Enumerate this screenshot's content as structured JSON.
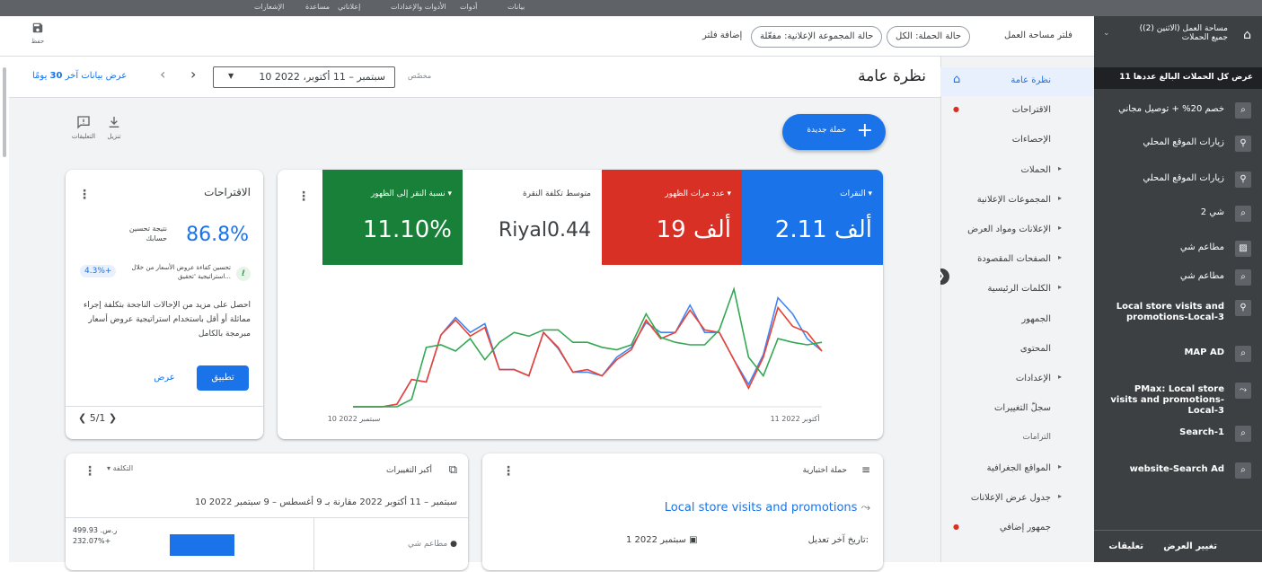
{
  "topbar": {
    "items": [
      "بيانات",
      "أدوات",
      "الأدوات والإعدادات",
      "إعلاناتي",
      "مساعدة",
      "الإشعارات"
    ]
  },
  "filters": {
    "add_filter": "إضافة فلتر",
    "chip_adgroup": "حالة المجموعة الإعلانية: مفعّلة",
    "chip_campaign": "حالة الحملة: الكل",
    "workspace_filter": "فلتر مساحة العمل",
    "save_label": "حفظ"
  },
  "account": {
    "line1": "مساحة العمل (الاثنين (2))",
    "line2": "جميع الحملات"
  },
  "campaign_nav": {
    "all_label": "عرض كل الحملات البالغ عددها 11",
    "items": [
      {
        "label": "خصم 20% + توصيل مجاني",
        "icon": "search-icon"
      },
      {
        "label": "زيارات الموقع المحلي",
        "icon": "location-icon"
      },
      {
        "label": "زيارات الموقع المحلي",
        "icon": "location-icon"
      },
      {
        "label": "شي 2",
        "icon": "search-icon"
      },
      {
        "label": "مطاعم شي",
        "icon": "display-icon"
      },
      {
        "label": "مطاعم شي",
        "icon": "search-icon"
      },
      {
        "label": "Local store visits and promotions-Local-3",
        "icon": "location-icon"
      },
      {
        "label": "MAP AD",
        "icon": "search-icon"
      },
      {
        "label": "PMax: Local store visits and promotions-Local-3",
        "icon": "performance-icon"
      },
      {
        "label": "Search-1",
        "icon": "search-icon"
      },
      {
        "label": "website-Search Ad",
        "icon": "search-icon"
      }
    ],
    "footer": {
      "feedback": "تعليقات",
      "change_view": "تغيير العرض"
    }
  },
  "page_nav": {
    "items": [
      "نظرة عامة",
      "الاقتراحات",
      "الإحصاءات",
      "الحملات",
      "المجموعات الإعلانية",
      "الإعلانات ومواد العرض",
      "الصفحات المقصودة",
      "الكلمات الرئيسية",
      "الجمهور",
      "المحتوى",
      "الإعدادات",
      "سجلّ التغييرات",
      "الترامات",
      "المواقع الجغرافية",
      "جدول عرض الإعلانات",
      "جمهور إضافي"
    ]
  },
  "header": {
    "title": "نظرة عامة",
    "custom_label": "مخصّص",
    "date_range": "10 سبتمبر – 11 أكتوبر، 2022",
    "last30_prefix": "عرض بيانات آخر",
    "last30_days": "30",
    "last30_suffix": "يومًا"
  },
  "tools": {
    "download": "تنزيل",
    "feedback": "التعليقات"
  },
  "new_campaign": "حملة جديدة",
  "suggestions": {
    "title": "الاقتراحات",
    "score": "86.8%",
    "score_label": "نتيجة تحسين حسابك",
    "boost": "4.3%+",
    "boost_text": "تحسين كفاءة عروض الأسعار من خلال استراتيجية 'تحقيق...",
    "desc": "احصل على مزيد من الإحالات الناجحة بتكلفة إجراء مماثلة أو أقل باستخدام استراتيجية عروض أسعار مبرمجة بالكامل",
    "apply": "تطبيق",
    "view": "عرض",
    "pager": "5/1"
  },
  "chart_data": {
    "type": "line",
    "x_start_label": "10 سبتمبر 2022",
    "x_end_label": "11 أكتوبر 2022",
    "ylim": [
      0,
      100
    ],
    "series": [
      {
        "name": "النقرات",
        "color": "#4285f4",
        "values": [
          0,
          0,
          0,
          2,
          22,
          20,
          58,
          72,
          60,
          67,
          30,
          30,
          25,
          60,
          47,
          28,
          28,
          25,
          40,
          48,
          68,
          60,
          60,
          82,
          60,
          60,
          38,
          18,
          42,
          88,
          75,
          55,
          45
        ]
      },
      {
        "name": "عدد مرات الظهور",
        "color": "#ea4335",
        "values": [
          0,
          0,
          0,
          2,
          22,
          20,
          58,
          70,
          57,
          64,
          30,
          30,
          25,
          60,
          48,
          28,
          30,
          25,
          38,
          46,
          70,
          55,
          60,
          78,
          62,
          60,
          38,
          15,
          40,
          80,
          65,
          60,
          45
        ]
      },
      {
        "name": "نسبة النقر إلى الظهور",
        "color": "#34a853",
        "values": [
          0,
          0,
          0,
          0,
          6,
          48,
          50,
          45,
          55,
          38,
          52,
          60,
          57,
          62,
          62,
          52,
          52,
          48,
          46,
          50,
          75,
          56,
          52,
          50,
          50,
          62,
          95,
          40,
          25,
          55,
          52,
          50,
          52
        ]
      }
    ]
  },
  "metrics": [
    {
      "label": "النقرات",
      "value": "2.11 ألف",
      "color": "#1a73e8",
      "dropdown": true
    },
    {
      "label": "عدد مرات الظهور",
      "value": "19 ألف",
      "color": "#d93025",
      "dropdown": true
    },
    {
      "label": "متوسط تكلفة النقرة",
      "value": "Riyal0.44",
      "color": "#ffffff",
      "dropdown": false
    },
    {
      "label": "نسبة النقر إلى الظهور",
      "value": "11.10%",
      "color": "#188038",
      "dropdown": true
    }
  ],
  "changes_card": {
    "title": "أكبر التغييرات",
    "metric_select": "التكلفة",
    "period": "10 سبتمبر – 11 أكتوبر 2022 مقارنة بـ 9 أغسطس – 9 سبتمبر 2022",
    "row_label": "مطاعم شي",
    "row_value": "ر.س. 499.93",
    "row_change": "232.07%+"
  },
  "trial_card": {
    "title": "حملة اختبارية",
    "campaign": "Local store visits and promotions",
    "last_modified_label": "تاريخ آخر تعديل:",
    "last_modified_value": "1 سبتمبر 2022"
  }
}
